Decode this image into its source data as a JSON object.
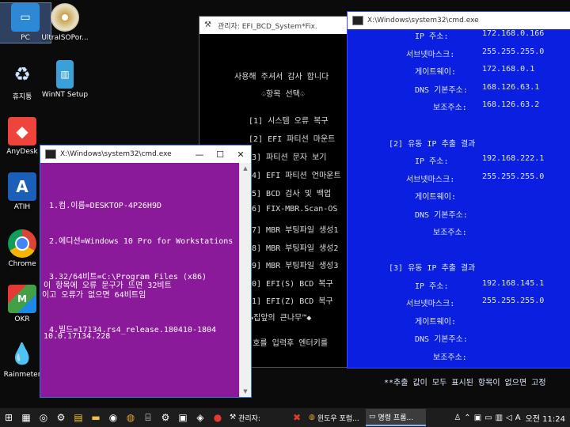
{
  "desktop": {
    "icons": [
      {
        "label": "PC"
      },
      {
        "label": "UltraISOPor..."
      },
      {
        "label": "휴지통"
      },
      {
        "label": "WinNT Setup"
      },
      {
        "label": "AnyDesk"
      },
      {
        "label": "ATIH"
      },
      {
        "label": "Chrome"
      },
      {
        "label": "OKR"
      },
      {
        "label": "Rainmeter"
      }
    ]
  },
  "efi_window": {
    "title": "관리자:          EFI_BCD_System*Fix.",
    "lines": [
      "사용해 주셔서 감사 합니다",
      "♤항목 선택♤",
      "[1] 시스템 오류 복구",
      "[2] EFI 파티션 마운트",
      "3] 파티션 문자 보기",
      "4] EFI 파티션 언마운트",
      "5] BCD 검사 및 백업",
      "6] FIX-MBR.Scan-OS",
      "7] MBR 부팅파일 생성1",
      "8] MBR 부팅파일 생성2",
      "9] MBR 부팅파일 생성3",
      "0] EFI(S) BCD 복구",
      "1] EFI(Z) BCD 복구",
      "◆집앞의 큰나무™◆",
      "번호를 입력후 엔터키를"
    ]
  },
  "blue_cmd": {
    "title": "X:\\Windows\\system32\\cmd.exe",
    "sections": [
      {
        "header": "",
        "rows": [
          {
            "label": "IP 주소:",
            "value": "172.168.0.166"
          },
          {
            "label": "서브넷마스크:",
            "value": "255.255.255.0"
          },
          {
            "label": "게이트웨이:",
            "value": "172.168.0.1"
          },
          {
            "label": "DNS 기본주소:",
            "value": "168.126.63.1"
          },
          {
            "label": "보조주소:",
            "value": "168.126.63.2"
          }
        ]
      },
      {
        "header": "[2] 유동 IP 추출 결과",
        "rows": [
          {
            "label": "IP 주소:",
            "value": "192.168.222.1"
          },
          {
            "label": "서브넷마스크:",
            "value": "255.255.255.0"
          },
          {
            "label": "게이트웨이:",
            "value": ""
          },
          {
            "label": "DNS 기본주소:",
            "value": ""
          },
          {
            "label": "보조주소:",
            "value": ""
          }
        ]
      },
      {
        "header": "[3] 유동 IP 추출 결과",
        "rows": [
          {
            "label": "IP 주소:",
            "value": "192.168.145.1"
          },
          {
            "label": "서브넷마스크:",
            "value": "255.255.255.0"
          },
          {
            "label": "게이트웨이:",
            "value": ""
          },
          {
            "label": "DNS 기본주소:",
            "value": ""
          },
          {
            "label": "보조주소:",
            "value": ""
          }
        ]
      }
    ],
    "footer": "**추출 값이 모두 표시된 항목이 없으면 고정"
  },
  "purple_cmd": {
    "title": "X:\\Windows\\system32\\cmd.exe",
    "lines": [
      "1.컴.이름=DESKTOP-4P26H9D",
      "2.에디션=Windows 10 Pro for Workstations",
      "3.32/64비트=C:\\Program Files (x86)",
      "          이 항목에 오류 문구가 뜨면 32비트",
      "이고 오류가 없으면 64비트임",
      "4.빌드=17134.rs4_release.180410-1804",
      "                  10.0.17134.228"
    ]
  },
  "taskbar": {
    "buttons": [
      {
        "label": "관리자:"
      },
      {
        "label": "윈도우 포럼..."
      },
      {
        "label": "명령 프롬..."
      }
    ],
    "ime": "A",
    "time": "오전 11:24"
  },
  "colors": {
    "blue_cmd_bg": "#0a1fe0",
    "purple_cmd_bg": "#8b1a9a",
    "efi_bg": "#000000",
    "taskbar_bg": "#1d1d1d"
  }
}
